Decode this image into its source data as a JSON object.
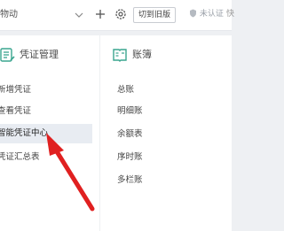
{
  "topbar": {
    "company_name": "物动",
    "switch_label": "切到旧版",
    "cert_label": "未认证",
    "edge_label": "快"
  },
  "menu": {
    "voucher_section": {
      "title": "凭证管理",
      "items": [
        {
          "label": "新增凭证"
        },
        {
          "label": "查看凭证"
        },
        {
          "label": "智能凭证中心"
        },
        {
          "label": "凭证汇总表"
        }
      ]
    },
    "ledger_section": {
      "title": "账簿",
      "items": [
        {
          "label": "总账"
        },
        {
          "label": "明细账"
        },
        {
          "label": "余额表"
        },
        {
          "label": "序时账"
        },
        {
          "label": "多栏账"
        }
      ]
    }
  },
  "colors": {
    "accent_teal": "#3aa58f",
    "hover_bg": "#e8ecf2",
    "arrow_red": "#e02020"
  }
}
